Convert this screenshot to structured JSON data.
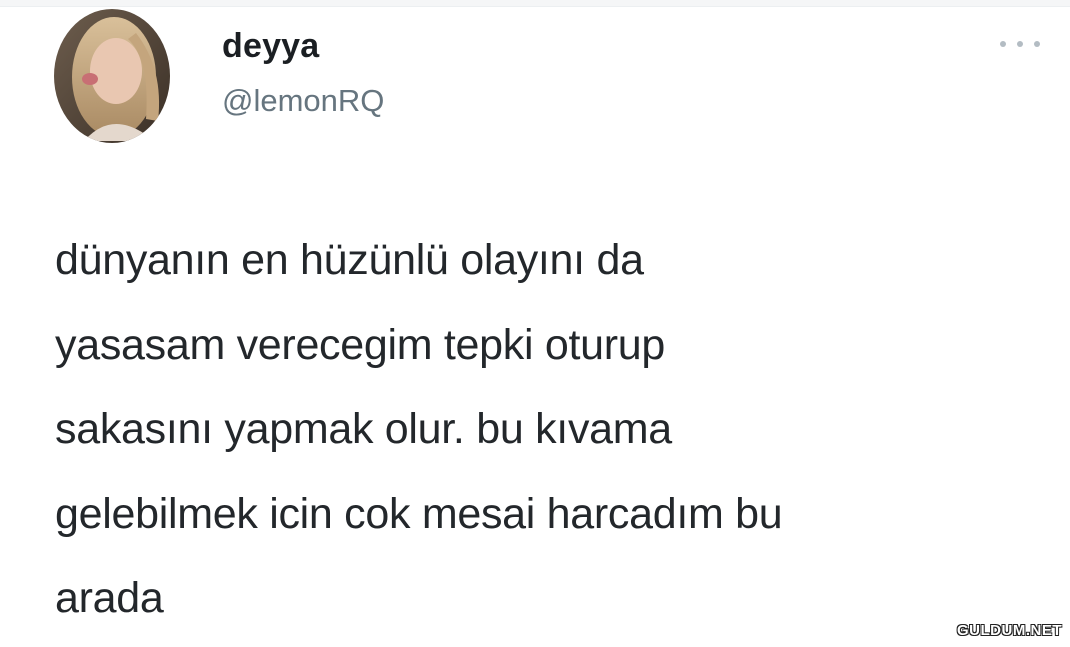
{
  "tweet": {
    "author": {
      "display_name": "deyya",
      "handle": "@lemonRQ",
      "avatar": "profile-photo"
    },
    "more_icon": "more-horizontal-icon",
    "text_lines": [
      "dünyanın en hüzünlü olayını da",
      "yasasam verecegim tepki oturup",
      "sakasını yapmak olur. bu kıvama",
      "gelebilmek icin cok mesai harcadım bu",
      "arada"
    ]
  },
  "watermark": {
    "text": "GULDUM.NET"
  },
  "colors": {
    "name": "#1b1f23",
    "handle": "#66757f",
    "body_text": "#23272b",
    "icon": "#b3bcc3",
    "background": "#ffffff"
  }
}
